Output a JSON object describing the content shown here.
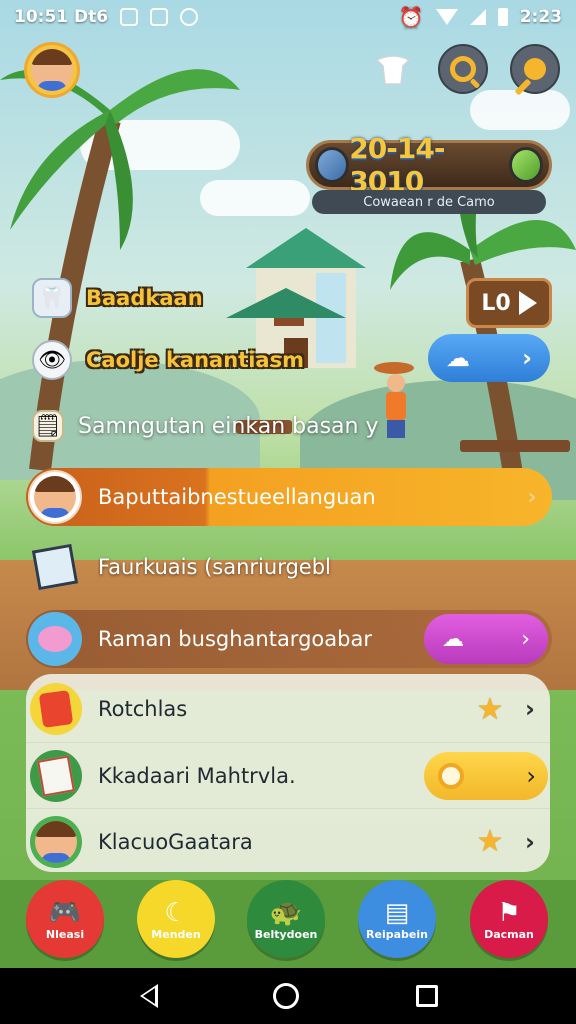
{
  "status_bar": {
    "time_left": "10:51 Dt6",
    "time_right": "2:23"
  },
  "top_bar": {
    "icons": [
      "hat-icon",
      "search-icon",
      "key-icon"
    ]
  },
  "score": {
    "value": "20-14-3010",
    "subtitle": "Cowaean r de Camo"
  },
  "level": {
    "label": "L0"
  },
  "floating_items": [
    {
      "label": "Baadkaan",
      "icon": "tooth-icon",
      "style": "yellow"
    },
    {
      "label": "Caolje kanantiasm",
      "icon": "eye-icon",
      "style": "yellow"
    },
    {
      "label": "Samngutan einkan basan y",
      "icon": "note-icon",
      "style": "white"
    }
  ],
  "cards": [
    {
      "label": "Baputtaibnestueellanguan",
      "style": "orange"
    },
    {
      "label": "Faurkuais (sanriurgebl",
      "style": "plain"
    },
    {
      "label": "Raman busghantargoabar",
      "style": "brown"
    }
  ],
  "list": [
    {
      "label": "Rotchlas",
      "accessory": "star"
    },
    {
      "label": "Kkadaari Mahtrvla.",
      "accessory": "toggle"
    },
    {
      "label": "KlacuoGaatara",
      "accessory": "star"
    }
  ],
  "bottom_nav": [
    {
      "label": "Nleasi",
      "icon": "controller-icon",
      "color": "#e53935"
    },
    {
      "label": "Menden",
      "icon": "moon-icon",
      "color": "#f5d82a"
    },
    {
      "label": "Beltydoen",
      "icon": "turtle-icon",
      "color": "#2e8b3e"
    },
    {
      "label": "Reipabein",
      "icon": "card-icon",
      "color": "#3d8de0"
    },
    {
      "label": "Dacman",
      "icon": "bookmark-icon",
      "color": "#d81b48"
    }
  ]
}
